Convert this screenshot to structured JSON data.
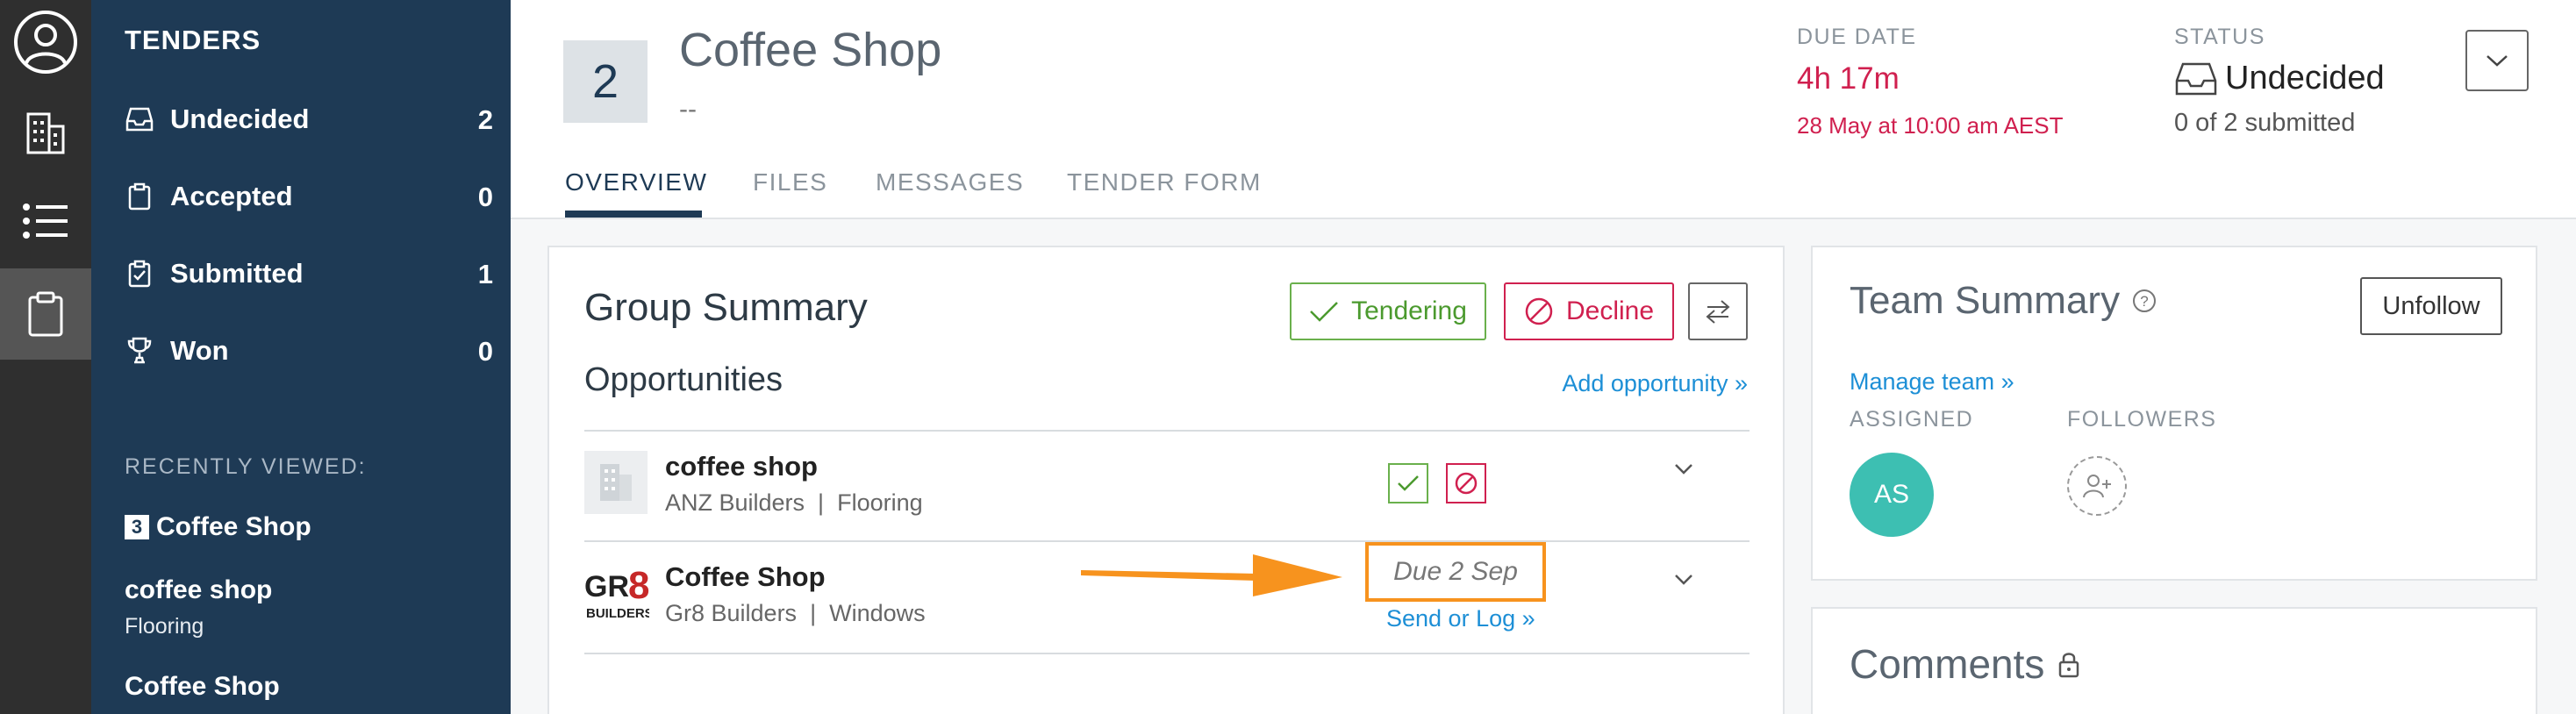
{
  "sidebar": {
    "title": "TENDERS",
    "items": [
      {
        "label": "Undecided",
        "count": "2",
        "icon": "inbox-icon"
      },
      {
        "label": "Accepted",
        "count": "0",
        "icon": "clipboard-icon"
      },
      {
        "label": "Submitted",
        "count": "1",
        "icon": "clipboard-check-icon"
      },
      {
        "label": "Won",
        "count": "0",
        "icon": "trophy-icon"
      }
    ],
    "recent_title": "RECENTLY VIEWED:",
    "recent": [
      {
        "badge": "3",
        "label": "Coffee Shop"
      },
      {
        "label": "coffee shop",
        "sub": "Flooring"
      },
      {
        "label": "Coffee Shop"
      }
    ]
  },
  "header": {
    "number": "2",
    "title": "Coffee Shop",
    "subtitle": "--",
    "due_label": "DUE DATE",
    "due_value": "4h 17m",
    "due_date": "28 May at 10:00 am AEST",
    "status_label": "STATUS",
    "status_value": "Undecided",
    "status_sub": "0 of 2 submitted",
    "tabs": [
      "OVERVIEW",
      "FILES",
      "MESSAGES",
      "TENDER FORM"
    ],
    "active_tab": "OVERVIEW"
  },
  "group_summary": {
    "title": "Group Summary",
    "tendering_label": "Tendering",
    "decline_label": "Decline",
    "opportunities_title": "Opportunities",
    "add_opportunity": "Add opportunity »",
    "rows": [
      {
        "name": "coffee shop",
        "company": "ANZ Builders",
        "trade": "Flooring",
        "logo": "building-icon"
      },
      {
        "name": "Coffee Shop",
        "company": "Gr8 Builders",
        "trade": "Windows",
        "logo": "gr8-builders-logo",
        "due": "Due 2 Sep",
        "send_log": "Send or Log »"
      }
    ]
  },
  "team_summary": {
    "title": "Team Summary",
    "unfollow_label": "Unfollow",
    "manage_team": "Manage team »",
    "assigned_label": "ASSIGNED",
    "followers_label": "FOLLOWERS",
    "assigned_initials": "AS"
  },
  "comments": {
    "title": "Comments"
  },
  "colors": {
    "sidebar": "#1e3a55",
    "rail": "#2f2f2f",
    "accent_red": "#d0204f",
    "accent_green": "#6ab04c",
    "link": "#1d8fd6",
    "highlight_orange": "#f7931e",
    "avatar": "#3dbfb2"
  }
}
